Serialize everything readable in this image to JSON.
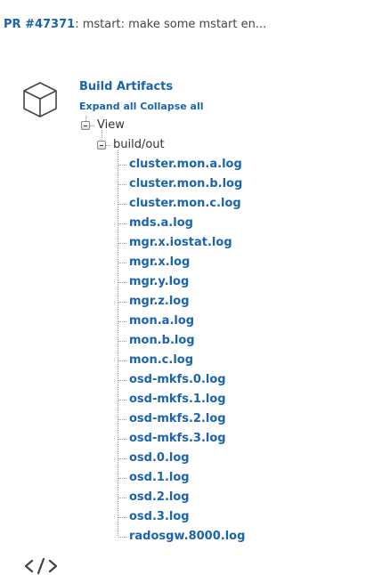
{
  "pr": {
    "link_label": "PR #47371",
    "separator": ": ",
    "title": "mstart: make some mstart en..."
  },
  "artifacts": {
    "heading": "Build Artifacts",
    "expand_all": "Expand all",
    "collapse_all": "Collapse all",
    "tree": {
      "root_label": "View",
      "folder_label": "build/out",
      "files": [
        "cluster.mon.a.log",
        "cluster.mon.b.log",
        "cluster.mon.c.log",
        "mds.a.log",
        "mgr.x.iostat.log",
        "mgr.x.log",
        "mgr.y.log",
        "mgr.z.log",
        "mon.a.log",
        "mon.b.log",
        "mon.c.log",
        "osd-mkfs.0.log",
        "osd-mkfs.1.log",
        "osd-mkfs.2.log",
        "osd-mkfs.3.log",
        "osd.0.log",
        "osd.1.log",
        "osd.2.log",
        "osd.3.log",
        "radosgw.8000.log"
      ]
    }
  },
  "icons": {
    "artifacts": "cube-icon",
    "next_section": "code-icon"
  },
  "colors": {
    "link": "#1a64b0",
    "text": "#333333",
    "tree_lines": "#999999"
  }
}
